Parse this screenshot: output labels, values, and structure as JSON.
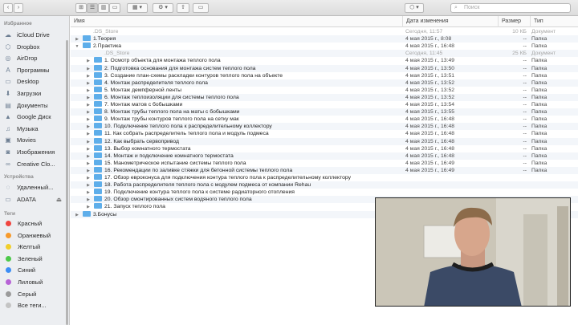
{
  "toolbar": {
    "back": "‹",
    "forward": "›",
    "view_icons": "⊞",
    "view_list": "☰",
    "view_columns": "▥",
    "view_cover": "▭",
    "arrange": "▦ ▾",
    "action": "⚙ ▾",
    "share": "⇧",
    "tag": "▭",
    "dropbox": "⬡ ▾",
    "search_placeholder": "Поиск"
  },
  "sidebar": {
    "favorites_header": "Избранное",
    "favorites": [
      {
        "label": "iCloud Drive",
        "icon": "☁"
      },
      {
        "label": "Dropbox",
        "icon": "⬡"
      },
      {
        "label": "AirDrop",
        "icon": "◎"
      },
      {
        "label": "Программы",
        "icon": "A"
      },
      {
        "label": "Desktop",
        "icon": "▭"
      },
      {
        "label": "Загрузки",
        "icon": "⬇"
      },
      {
        "label": "Документы",
        "icon": "▤"
      },
      {
        "label": "Google Диск",
        "icon": "▲"
      },
      {
        "label": "Музыка",
        "icon": "♫"
      },
      {
        "label": "Movies",
        "icon": "▣"
      },
      {
        "label": "Изображения",
        "icon": "◙"
      },
      {
        "label": "Creative Clo...",
        "icon": "∞"
      }
    ],
    "devices_header": "Устройства",
    "devices": [
      {
        "label": "Удаленный...",
        "icon": "◌"
      },
      {
        "label": "ADATA",
        "icon": "▭",
        "eject": "⏏"
      }
    ],
    "tags_header": "Теги",
    "tags": [
      {
        "label": "Красный",
        "color": "#f0453f"
      },
      {
        "label": "Оранжевый",
        "color": "#f79a2b"
      },
      {
        "label": "Желтый",
        "color": "#f1cf2b"
      },
      {
        "label": "Зеленый",
        "color": "#4cc94a"
      },
      {
        "label": "Синий",
        "color": "#3c8ef5"
      },
      {
        "label": "Лиловый",
        "color": "#b763d6"
      },
      {
        "label": "Серый",
        "color": "#9b9b9b"
      },
      {
        "label": "Все теги...",
        "color": "#c4c4c4"
      }
    ]
  },
  "columns": {
    "name": "Имя",
    "date": "Дата изменения",
    "size": "Размер",
    "kind": "Тип"
  },
  "rows": [
    {
      "level": 0,
      "tri": "",
      "folder": false,
      "ghost": true,
      "name": ".DS_Store",
      "date": "Сегодня, 11:57",
      "size": "10 КБ",
      "kind": "Документ"
    },
    {
      "level": 0,
      "tri": "▶",
      "folder": true,
      "ghost": false,
      "name": "1.Теория",
      "date": "4 мая 2015 г., 8:08",
      "size": "--",
      "kind": "Папка"
    },
    {
      "level": 0,
      "tri": "▼",
      "folder": true,
      "ghost": false,
      "name": "2.Практика",
      "date": "4 мая 2015 г., 16:48",
      "size": "--",
      "kind": "Папка"
    },
    {
      "level": 1,
      "tri": "",
      "folder": false,
      "ghost": true,
      "name": ".DS_Store",
      "date": "Сегодня, 11:45",
      "size": "25 КБ",
      "kind": "Документ"
    },
    {
      "level": 1,
      "tri": "▶",
      "folder": true,
      "ghost": false,
      "name": "1. Осмотр объекта для монтажа теплого пола",
      "date": "4 мая 2015 г., 13:49",
      "size": "--",
      "kind": "Папка"
    },
    {
      "level": 1,
      "tri": "▶",
      "folder": true,
      "ghost": false,
      "name": "2. Подготовка основания для монтажа систем теплого пола",
      "date": "4 мая 2015 г., 13:50",
      "size": "--",
      "kind": "Папка"
    },
    {
      "level": 1,
      "tri": "▶",
      "folder": true,
      "ghost": false,
      "name": "3. Создание план-схемы раскладки контуров теплого пола на объекте",
      "date": "4 мая 2015 г., 13:51",
      "size": "--",
      "kind": "Папка"
    },
    {
      "level": 1,
      "tri": "▶",
      "folder": true,
      "ghost": false,
      "name": "4. Монтаж распределителя теплого пола",
      "date": "4 мая 2015 г., 13:52",
      "size": "--",
      "kind": "Папка"
    },
    {
      "level": 1,
      "tri": "▶",
      "folder": true,
      "ghost": false,
      "name": "5. Монтаж демпферной ленты",
      "date": "4 мая 2015 г., 13:52",
      "size": "--",
      "kind": "Папка"
    },
    {
      "level": 1,
      "tri": "▶",
      "folder": true,
      "ghost": false,
      "name": "6. Монтаж теплоизоляции для системы теплого пола",
      "date": "4 мая 2015 г., 13:52",
      "size": "--",
      "kind": "Папка"
    },
    {
      "level": 1,
      "tri": "▶",
      "folder": true,
      "ghost": false,
      "name": "7. Монтаж матов с бобышками",
      "date": "4 мая 2015 г., 13:54",
      "size": "--",
      "kind": "Папка"
    },
    {
      "level": 1,
      "tri": "▶",
      "folder": true,
      "ghost": false,
      "name": "8. Монтаж трубы теплого пола на маты с бобышками",
      "date": "4 мая 2015 г., 13:55",
      "size": "--",
      "kind": "Папка"
    },
    {
      "level": 1,
      "tri": "▶",
      "folder": true,
      "ghost": false,
      "name": "9. Монтаж трубы контуров теплого пола на сетку мак",
      "date": "4 мая 2015 г., 16:48",
      "size": "--",
      "kind": "Папка"
    },
    {
      "level": 1,
      "tri": "▶",
      "folder": true,
      "ghost": false,
      "name": "10. Подключение теплого пола к распределительному коллектору",
      "date": "4 мая 2015 г., 16:48",
      "size": "--",
      "kind": "Папка"
    },
    {
      "level": 1,
      "tri": "▶",
      "folder": true,
      "ghost": false,
      "name": "11. Как собрать распределитель теплого пола и модуль подмеса",
      "date": "4 мая 2015 г., 16:48",
      "size": "--",
      "kind": "Папка"
    },
    {
      "level": 1,
      "tri": "▶",
      "folder": true,
      "ghost": false,
      "name": "12. Как выбрать сервопривод",
      "date": "4 мая 2015 г., 16:48",
      "size": "--",
      "kind": "Папка"
    },
    {
      "level": 1,
      "tri": "▶",
      "folder": true,
      "ghost": false,
      "name": "13. Выбор комнатного термостата",
      "date": "4 мая 2015 г., 16:48",
      "size": "--",
      "kind": "Папка"
    },
    {
      "level": 1,
      "tri": "▶",
      "folder": true,
      "ghost": false,
      "name": "14. Монтаж и подключение комнатного термостата",
      "date": "4 мая 2015 г., 16:48",
      "size": "--",
      "kind": "Папка"
    },
    {
      "level": 1,
      "tri": "▶",
      "folder": true,
      "ghost": false,
      "name": "15. Манометрическое испытание системы теплого пола",
      "date": "4 мая 2015 г., 16:49",
      "size": "--",
      "kind": "Папка"
    },
    {
      "level": 1,
      "tri": "▶",
      "folder": true,
      "ghost": false,
      "name": "16. Рекомендации по заливке стяжки для бетонной системы теплого пола",
      "date": "4 мая 2015 г., 16:49",
      "size": "--",
      "kind": "Папка"
    },
    {
      "level": 1,
      "tri": "▶",
      "folder": true,
      "ghost": false,
      "name": "17. Обзор евроконуса для подключения контура теплого пола к распределительному коллектору",
      "date": "",
      "size": "",
      "kind": ""
    },
    {
      "level": 1,
      "tri": "▶",
      "folder": true,
      "ghost": false,
      "name": "18. Работа распределителя теплого пола с модулем подмеса от компании Rehau",
      "date": "",
      "size": "",
      "kind": ""
    },
    {
      "level": 1,
      "tri": "▶",
      "folder": true,
      "ghost": false,
      "name": "19. Подключение контура теплого пола к системе радиаторного отопления",
      "date": "",
      "size": "",
      "kind": ""
    },
    {
      "level": 1,
      "tri": "▶",
      "folder": true,
      "ghost": false,
      "name": "20. Обзор смонтированных систем водяного теплого пола",
      "date": "",
      "size": "",
      "kind": ""
    },
    {
      "level": 1,
      "tri": "▶",
      "folder": true,
      "ghost": false,
      "name": "21. Запуск теплого пола",
      "date": "",
      "size": "",
      "kind": ""
    },
    {
      "level": 0,
      "tri": "▶",
      "folder": true,
      "ghost": false,
      "name": "3.Бонусы",
      "date": "",
      "size": "",
      "kind": ""
    }
  ]
}
